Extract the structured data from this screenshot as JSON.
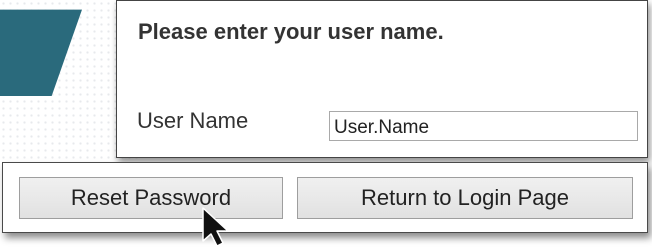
{
  "dialog": {
    "prompt": "Please enter your user name.",
    "username_label": "User Name",
    "username_value": "User.Name"
  },
  "buttons": {
    "reset_password": "Reset Password",
    "return_to_login": "Return to Login Page"
  },
  "icons": {
    "cursor": "mouse-pointer-icon"
  },
  "colors": {
    "accent": "#2a6a7c",
    "button_background": "#e6e6e6"
  }
}
